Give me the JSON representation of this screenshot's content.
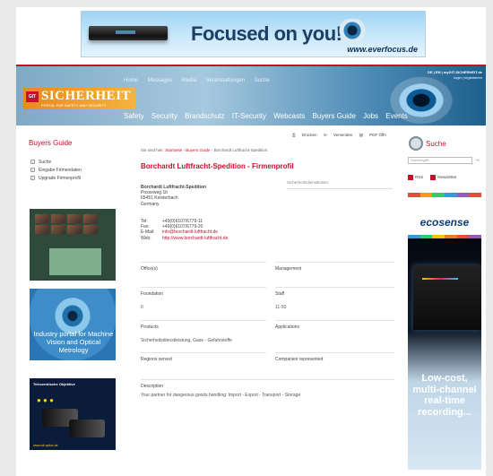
{
  "top_ad": {
    "tagline": "Focused on you!",
    "url": "www.everfocus.de"
  },
  "header": {
    "logo_word": "SICHERHEIT",
    "logo_git": "GIT",
    "logo_tagline": "PORTAL FÜR SAFETY UND SECURITY",
    "top_nav": [
      "Home",
      "Messages",
      "Media",
      "Veranstaltungen",
      "Suche"
    ],
    "main_nav": [
      "Safety",
      "Security",
      "Brandschutz",
      "IT-Security",
      "Webcasts",
      "Buyers Guide",
      "Jobs",
      "Events"
    ],
    "login_line1": "DE | EN | myGIT-SICHERHEIT.de",
    "login_line2": "login | registrieren"
  },
  "sidebar_left": {
    "title": "Buyers Guide",
    "menu": [
      "Suche",
      "Eingabe Firmendaten",
      "Upgrade Firmenprofil"
    ],
    "ad_machine_vision": "Industry portal for Machine Vision and Optical Metrology",
    "ad_lens_header": "Telecentrische Objektive",
    "ad_lens_footer": "www.sill-optics.de"
  },
  "actions": {
    "print": "Drucken",
    "send": "Versenden",
    "pdf": "PDF Öffn"
  },
  "breadcrumb": {
    "prefix": "Sie sind hier:",
    "links": [
      "Startseite",
      "Buyers Guide"
    ],
    "current": "Borchardt Luftfracht-Spedition"
  },
  "main": {
    "title": "Borchardt Luftfracht-Spedition - Firmenprofil",
    "address": [
      "Borchardt Luftfracht-Spedition",
      "Posseweg 1b",
      "65451 Kelsterbach",
      "Germany"
    ],
    "contact": [
      {
        "k": "Tel:",
        "v": "+49(0)6107/6779-11"
      },
      {
        "k": "Fax:",
        "v": "+49(0)6107/6779-20"
      },
      {
        "k": "E-Mail:",
        "v": "info@borchardt-luftfracht.de"
      },
      {
        "k": "Web:",
        "v": "http://www.borchardt-luftfracht.de"
      }
    ],
    "logo_label": "Sicherheitsdienstleister",
    "offices_label": "Office(s)",
    "management_label": "Management",
    "foundation_label": "Foundation",
    "foundation_value": "0",
    "staff_label": "Staff",
    "staff_value": "11-50",
    "products_label": "Products",
    "products_value": "Sicherheitsdienstleistung, Gase - Gefahrstoffe",
    "applications_label": "Applications",
    "regions_label": "Regions served",
    "companies_label": "Companies represented",
    "description_label": "Description",
    "description_value": "Your partner for dangerous goods handling: Import - Export - Transport - Storage"
  },
  "sidebar_right": {
    "search_title": "Suche",
    "search_placeholder": "Suchbegriff...",
    "rss_label": "RSS",
    "newsletter_label": "Newsletter",
    "eco_brand": "ecosense",
    "ad_text": "Low-cost, multi-channel real-time recording..."
  },
  "colors": {
    "accent": "#c8102e",
    "header_blue": "#4d8bb5"
  }
}
